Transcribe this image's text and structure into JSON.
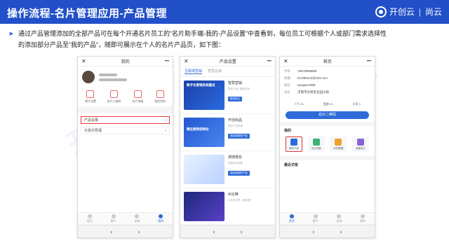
{
  "header": {
    "title": "操作流程-名片管理应用-产品管理",
    "logo_text": "开创云",
    "logo_brand": "尚云"
  },
  "description": {
    "line1": "通过产品管理添加的全部产品可在每个开通名片员工的“名片助手端-我的-产品设置”中查看到，每位员工可根据个人或部门需求选择性",
    "line2": "的添加部分产品至“我的产品”，随即可展示在个人的名片产品页，如下图："
  },
  "phone1": {
    "title": "我的",
    "icons": [
      "简片设置",
      "名片二维码",
      "名片海报",
      "我的资料"
    ],
    "menu": [
      "产品设置",
      "分享引导语"
    ],
    "tabs": [
      "首页",
      "客户",
      "咨询",
      "我的"
    ]
  },
  "phone2": {
    "title": "产品设置",
    "tabs": [
      "互联网营销",
      "智慧云库"
    ],
    "products": [
      {
        "img_caption": "数字化营销系统建设",
        "name": "智慧营销",
        "sub": "更多产品 | 营销好用",
        "btn": "取消关注"
      },
      {
        "img_caption": "精品营销型网站",
        "name": "开创尚品",
        "sub": "更多产品详情",
        "btn": "添加到我的产品"
      },
      {
        "img_caption": "",
        "name": "搜搜排名",
        "sub": "快速优化效果",
        "btn": "添加到我的产品"
      },
      {
        "img_caption": "",
        "name": "AI云推",
        "sub": "AI生成文章，精准推广",
        "btn": ""
      }
    ]
  },
  "phone3": {
    "title": "首页",
    "info": [
      {
        "k": "手机",
        "v": "15678969888"
      },
      {
        "k": "邮箱",
        "v": "KC986210@163.com"
      },
      {
        "k": "微信",
        "v": "aungsize998"
      },
      {
        "k": "地址",
        "v": "济南市天桥区北园大街"
      }
    ],
    "stats": [
      "人气 35",
      "靠谱 43",
      "分享 9"
    ],
    "button": "名片二维码",
    "section_mine": "我的",
    "grid": [
      "我的产品",
      "今日访客",
      "实时数据",
      "海报名片"
    ],
    "section_recent": "最近访客",
    "tabs": [
      "首页",
      "客户",
      "咨询",
      "我的"
    ]
  },
  "colors": {
    "brand": "#2150c8",
    "accent": "#2f6bd8",
    "highlight": "#e53333"
  }
}
